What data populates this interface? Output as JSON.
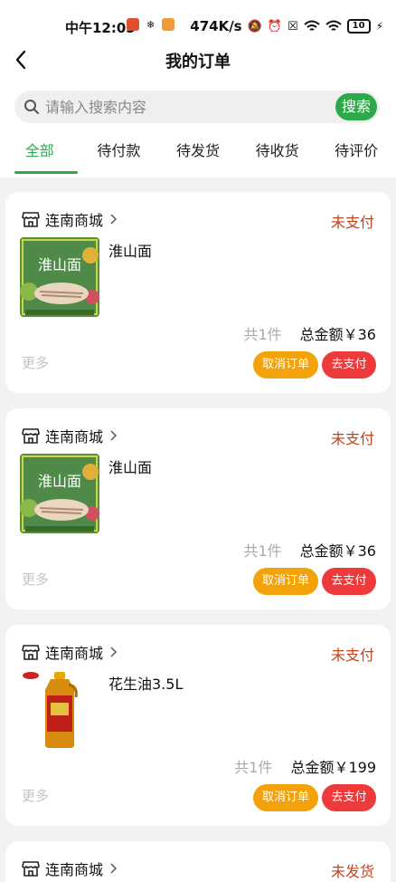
{
  "status_bar": {
    "time": "中午12:05",
    "network_speed": "474K/s",
    "battery": "10"
  },
  "header": {
    "title": "我的订单"
  },
  "search": {
    "placeholder": "请输入搜索内容",
    "button_label": "搜索"
  },
  "tabs": [
    {
      "label": "全部",
      "active": true
    },
    {
      "label": "待付款"
    },
    {
      "label": "待发货"
    },
    {
      "label": "待收货"
    },
    {
      "label": "待评价"
    }
  ],
  "colors": {
    "accent": "#2fa84a",
    "status": "#c4431d",
    "cancel": "#f2a20a",
    "pay": "#ee3a3a"
  },
  "orders": [
    {
      "store": "连南商城",
      "status": "未支付",
      "product": "淮山面",
      "thumb_text": "淮山面",
      "quantity": "共1件",
      "total": "总金额￥36",
      "more": "更多",
      "cancel_label": "取消订单",
      "pay_label": "去支付"
    },
    {
      "store": "连南商城",
      "status": "未支付",
      "product": "淮山面",
      "thumb_text": "淮山面",
      "quantity": "共1件",
      "total": "总金额￥36",
      "more": "更多",
      "cancel_label": "取消订单",
      "pay_label": "去支付"
    },
    {
      "store": "连南商城",
      "status": "未支付",
      "product": "花生油3.5L",
      "quantity": "共1件",
      "total": "总金额￥199",
      "more": "更多",
      "cancel_label": "取消订单",
      "pay_label": "去支付"
    },
    {
      "store": "连南商城",
      "status": "未发货"
    }
  ]
}
